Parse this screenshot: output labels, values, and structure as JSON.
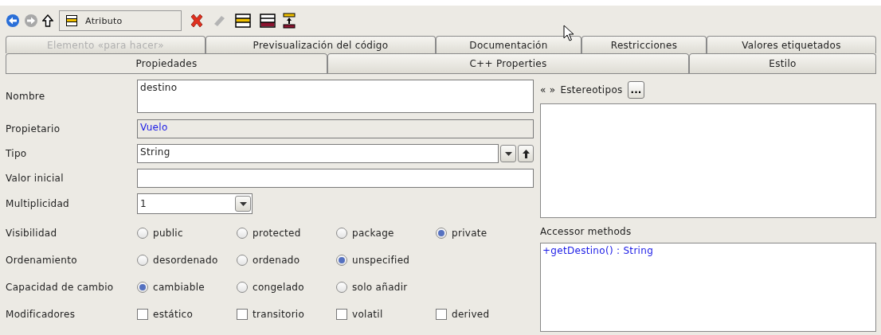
{
  "toolbar": {
    "nav": [
      {
        "kind": "back",
        "disabled": false
      },
      {
        "kind": "forward",
        "disabled": true
      },
      {
        "kind": "up",
        "disabled": false
      }
    ],
    "selector": {
      "value": "Atributo"
    },
    "actions": [
      {
        "kind": "delete",
        "disabled": false
      },
      {
        "kind": "eraser",
        "disabled": true
      },
      {
        "kind": "class-yellow",
        "disabled": false
      },
      {
        "kind": "class-red",
        "disabled": false
      },
      {
        "kind": "class-up",
        "disabled": false
      }
    ]
  },
  "tab_rows": [
    [
      {
        "label": "Elemento «para hacer»",
        "selected": false,
        "disabled": true
      },
      {
        "label": "Previsualización del código",
        "selected": false,
        "disabled": false
      },
      {
        "label": "Documentación",
        "selected": false,
        "disabled": false
      },
      {
        "label": "Restricciones",
        "selected": false,
        "disabled": false
      },
      {
        "label": "Valores etiquetados",
        "selected": false,
        "disabled": false
      }
    ],
    [
      {
        "label": "Propiedades",
        "selected": true,
        "disabled": false
      },
      {
        "label": "C++ Properties",
        "selected": false,
        "disabled": false
      },
      {
        "label": "Estilo",
        "selected": false,
        "disabled": false
      }
    ]
  ],
  "fields": [
    {
      "label": "Nombre",
      "kind": "textarea",
      "value": "destino"
    },
    {
      "label": "Propietario",
      "kind": "link",
      "value": "Vuelo"
    },
    {
      "label": "Tipo",
      "kind": "combo-nav",
      "value": "String"
    },
    {
      "label": "Valor inicial",
      "kind": "text"
    },
    {
      "label": "Multiplicidad",
      "kind": "combo",
      "value": "1"
    }
  ],
  "option_rows": [
    {
      "label": "Visibilidad",
      "kind": "radio",
      "options": [
        {
          "label": "public",
          "selected": false
        },
        {
          "label": "protected",
          "selected": false
        },
        {
          "label": "package",
          "selected": false
        },
        {
          "label": "private",
          "selected": true
        }
      ]
    },
    {
      "label": "Ordenamiento",
      "kind": "radio",
      "options": [
        {
          "label": "desordenado",
          "selected": false
        },
        {
          "label": "ordenado",
          "selected": false
        },
        {
          "label": "unspecified",
          "selected": true
        }
      ]
    },
    {
      "label": "Capacidad de cambio",
      "kind": "radio",
      "options": [
        {
          "label": "cambiable",
          "selected": true
        },
        {
          "label": "congelado",
          "selected": false
        },
        {
          "label": "solo añadir",
          "selected": false
        }
      ]
    },
    {
      "label": "Modificadores",
      "kind": "checkbox",
      "options": [
        {
          "label": "estático",
          "checked": false
        },
        {
          "label": "transitorio",
          "checked": false
        },
        {
          "label": "volatil",
          "checked": false
        },
        {
          "label": "derived",
          "checked": false
        }
      ]
    }
  ],
  "stereotypes": {
    "arrows": "« »",
    "label": "Estereotipos",
    "button": "..."
  },
  "accessors": {
    "label": "Accessor methods",
    "items": [
      "+getDestino() : String"
    ]
  }
}
